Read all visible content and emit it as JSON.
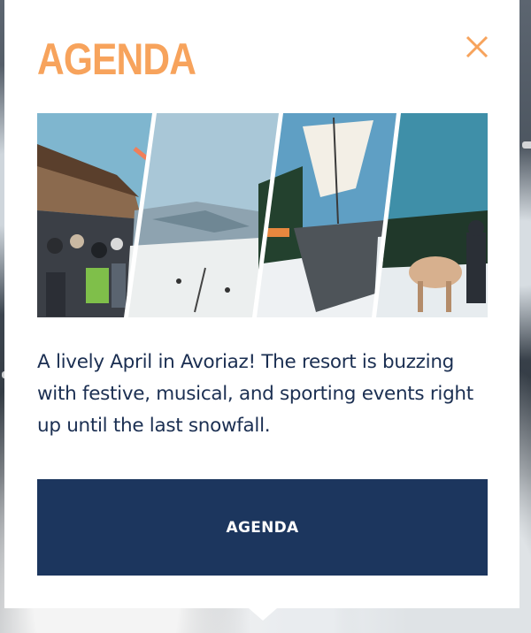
{
  "popup": {
    "title": "AGENDA",
    "close_icon": "close-icon",
    "image_icon": "event-collage-image",
    "description": "A lively April in Avoriaz! The resort is buzzing with festive, musical, and sporting events right up until the last snowfall.",
    "cta_label": "AGENDA"
  },
  "colors": {
    "title": "#f7a35c",
    "close": "#f7a35c",
    "text": "#1b2f52",
    "button_bg": "#1c365e",
    "button_text": "#ffffff"
  }
}
